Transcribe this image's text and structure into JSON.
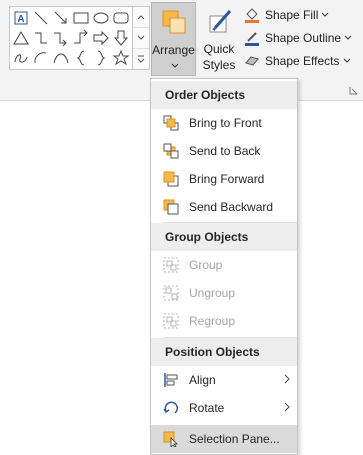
{
  "ribbon": {
    "arrange_label": "Arrange",
    "quick_label_1": "Quick",
    "quick_label_2": "Styles",
    "shape_fill": "Shape Fill",
    "shape_outline": "Shape Outline",
    "shape_effects": "Shape Effects",
    "text_box_glyph": "A"
  },
  "menu": {
    "order_header": "Order Objects",
    "bring_to_front": "Bring to Front",
    "send_to_back": "Send to Back",
    "bring_forward": "Bring Forward",
    "send_backward": "Send Backward",
    "group_header": "Group Objects",
    "group": "Group",
    "ungroup": "Ungroup",
    "regroup": "Regroup",
    "position_header": "Position Objects",
    "align": "Align",
    "rotate": "Rotate",
    "selection_pane": "Selection Pane..."
  },
  "colors": {
    "accent_orange": "#f5b84a",
    "accent_orange_dark": "#d89323",
    "icon_gray": "#505050",
    "blue": "#2b579a"
  }
}
